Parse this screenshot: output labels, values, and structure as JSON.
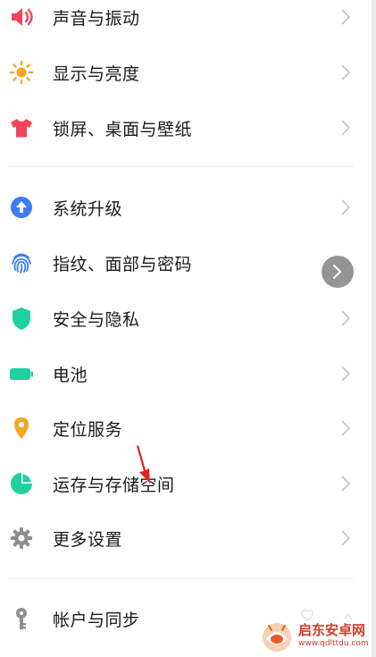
{
  "settings": {
    "items": [
      {
        "label": "声音与振动",
        "icon": "speaker-icon",
        "color": "#f0455b"
      },
      {
        "label": "显示与亮度",
        "icon": "sun-icon",
        "color": "#f5a623"
      },
      {
        "label": "锁屏、桌面与壁纸",
        "icon": "tshirt-icon",
        "color": "#f0455b"
      },
      {
        "label": "系统升级",
        "icon": "upgrade-arrow-icon",
        "color": "#3b7cf5"
      },
      {
        "label": "指纹、面部与密码",
        "icon": "fingerprint-icon",
        "color": "#3b7cf5"
      },
      {
        "label": "安全与隐私",
        "icon": "shield-icon",
        "color": "#1fd0a0"
      },
      {
        "label": "电池",
        "icon": "battery-icon",
        "color": "#1fd0a0"
      },
      {
        "label": "定位服务",
        "icon": "location-pin-icon",
        "color": "#f5a623"
      },
      {
        "label": "运存与存储空间",
        "icon": "storage-pie-icon",
        "color": "#1fd0a0"
      },
      {
        "label": "更多设置",
        "icon": "gear-icon",
        "color": "#8e8e8e"
      },
      {
        "label": "帐户与同步",
        "icon": "key-icon",
        "color": "#8e8e8e"
      }
    ]
  },
  "overlay": {
    "float_button_icon": "chevron-right-icon",
    "annotation_arrow_color": "#e8201b"
  },
  "watermark": {
    "title": "启东安卓网",
    "url": "www.qdlttdu.com"
  },
  "colors": {
    "chevron": "#c4c4c4",
    "divider": "#efefef",
    "text": "#1a1a1a"
  }
}
